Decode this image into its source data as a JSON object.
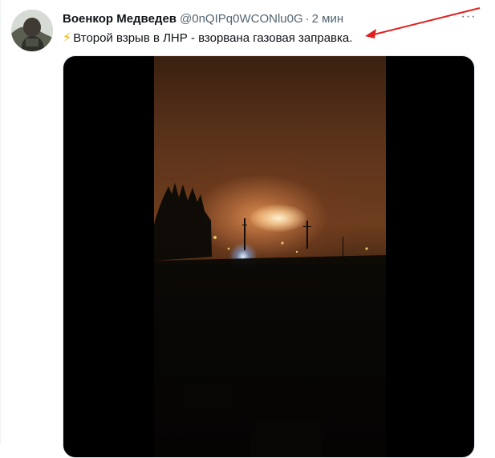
{
  "tweet": {
    "author_name": "Военкор Медведев",
    "handle": "@0nQIPq0WCONlu0G",
    "separator": "·",
    "time": "2 мин",
    "more_label": "···",
    "bolt_icon": "⚡",
    "text": "Второй взрыв в ЛНР - взорвана газовая заправка.",
    "media": {
      "type": "video",
      "description_icon": "video-frame"
    }
  },
  "annotation": {
    "arrow_color": "#e0201e"
  }
}
